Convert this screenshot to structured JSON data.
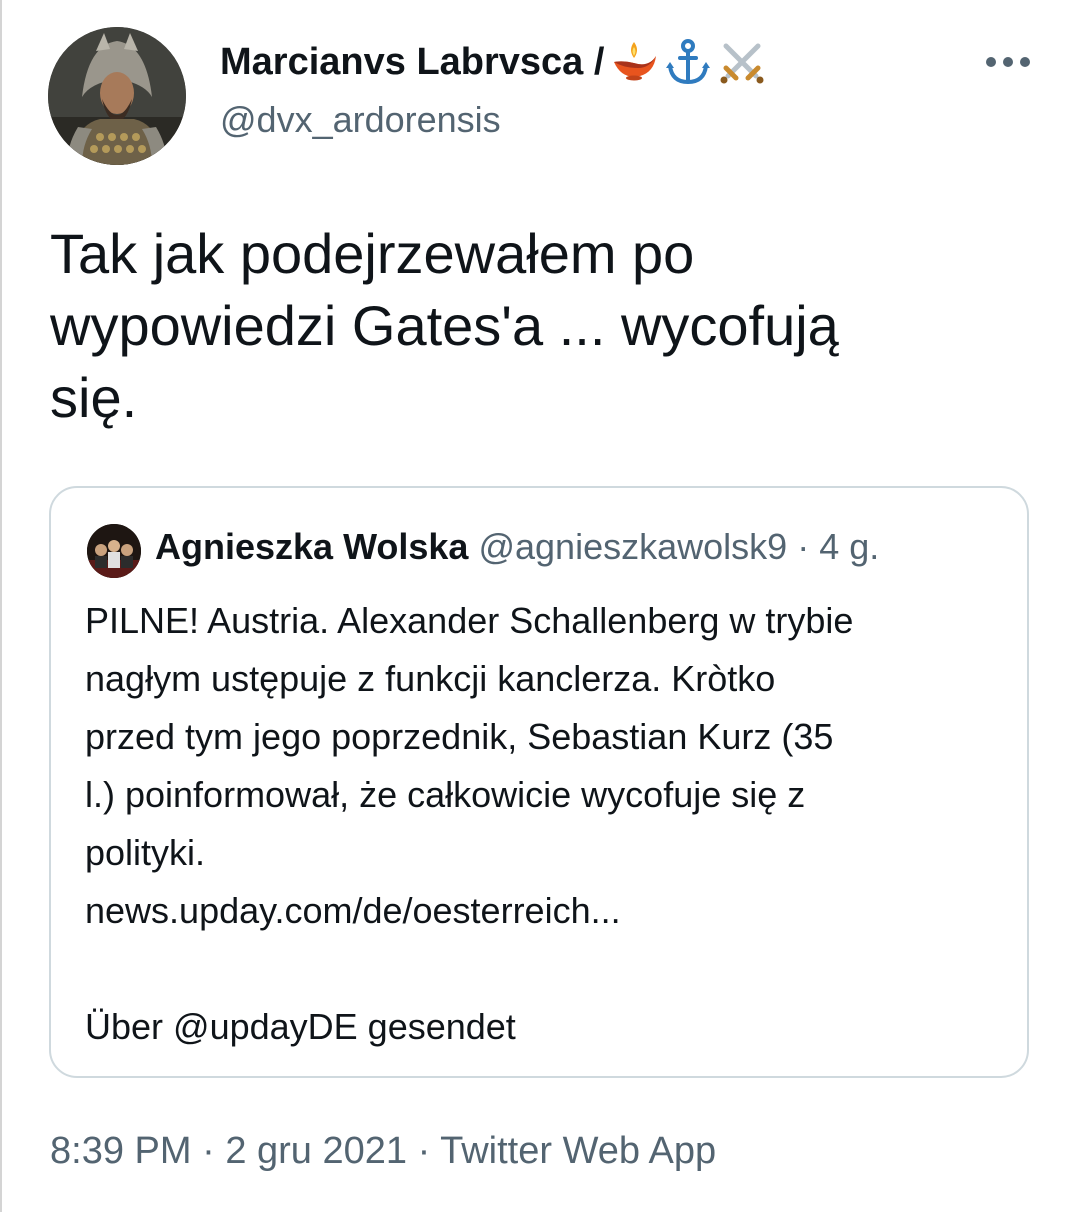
{
  "author": {
    "display_name": "Marcianvs Labrvsca /",
    "handle": "@dvx_ardorensis",
    "name_emojis": [
      "oil-lamp-icon",
      "anchor-icon",
      "crossed-swords-icon"
    ]
  },
  "tweet": {
    "text": "Tak jak podejrzewałem po\nwypowiedzi Gates'a ... wycofują\nsię."
  },
  "quoted_tweet": {
    "display_name": "Agnieszka Wolska",
    "handle": "@agnieszkawolsk9",
    "separator": "·",
    "time_ago": "4 g.",
    "lines": [
      "PILNE! Austria. Alexander Schallenberg w trybie",
      "nagłym ustępuje z funkcji kanclerza. Kròtko",
      "przed tym jego poprzednik, Sebastian Kurz (35",
      "l.) poinformował, że całkowicie wycofuje się z",
      "polityki.",
      "news.upday.com/de/oesterreich...",
      "",
      "Über @updayDE gesendet"
    ]
  },
  "meta": {
    "time": "8:39 PM",
    "date": "2 gru 2021",
    "source": "Twitter Web App",
    "separator": "·"
  },
  "colors": {
    "text_primary": "#0f1419",
    "text_secondary": "#536471",
    "border": "#cfd9de"
  }
}
